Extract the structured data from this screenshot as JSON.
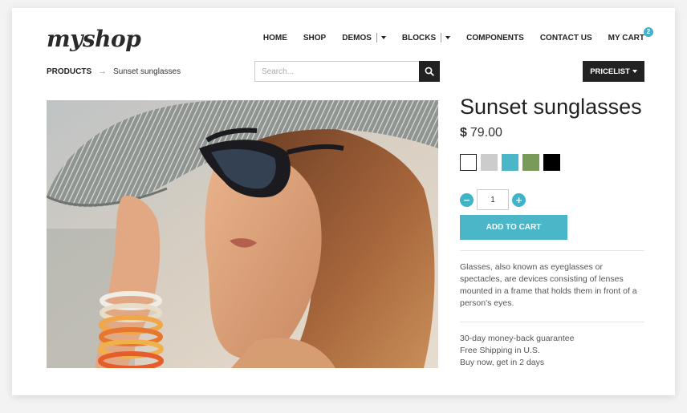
{
  "brand": {
    "logo": "myshop"
  },
  "nav": {
    "items": [
      {
        "label": "HOME"
      },
      {
        "label": "SHOP"
      },
      {
        "label": "DEMOS"
      },
      {
        "label": "BLOCKS"
      },
      {
        "label": "COMPONENTS"
      },
      {
        "label": "CONTACT US"
      },
      {
        "label": "MY CART"
      }
    ],
    "cart_count": "2"
  },
  "breadcrumb": {
    "root": "PRODUCTS",
    "arrow": "→",
    "current": "Sunset sunglasses"
  },
  "search": {
    "placeholder": "Search...",
    "value": ""
  },
  "pricelist": {
    "label": "PRICELIST"
  },
  "product": {
    "title": "Sunset sunglasses",
    "currency": "$",
    "price": "79.00",
    "swatches": [
      "#ffffff",
      "#cccccc",
      "#4bb6c8",
      "#7a9a5a",
      "#000000"
    ],
    "quantity": "1",
    "add_to_cart": "ADD TO CART",
    "description": "Glasses, also known as eyeglasses or spectacles, are devices consisting of lenses mounted in a frame that holds them in front of a person's eyes.",
    "perks": [
      "30-day money-back guarantee",
      "Free Shipping in U.S.",
      "Buy now, get in 2 days"
    ]
  },
  "colors": {
    "accent": "#4bb6c8",
    "dark": "#222222"
  }
}
